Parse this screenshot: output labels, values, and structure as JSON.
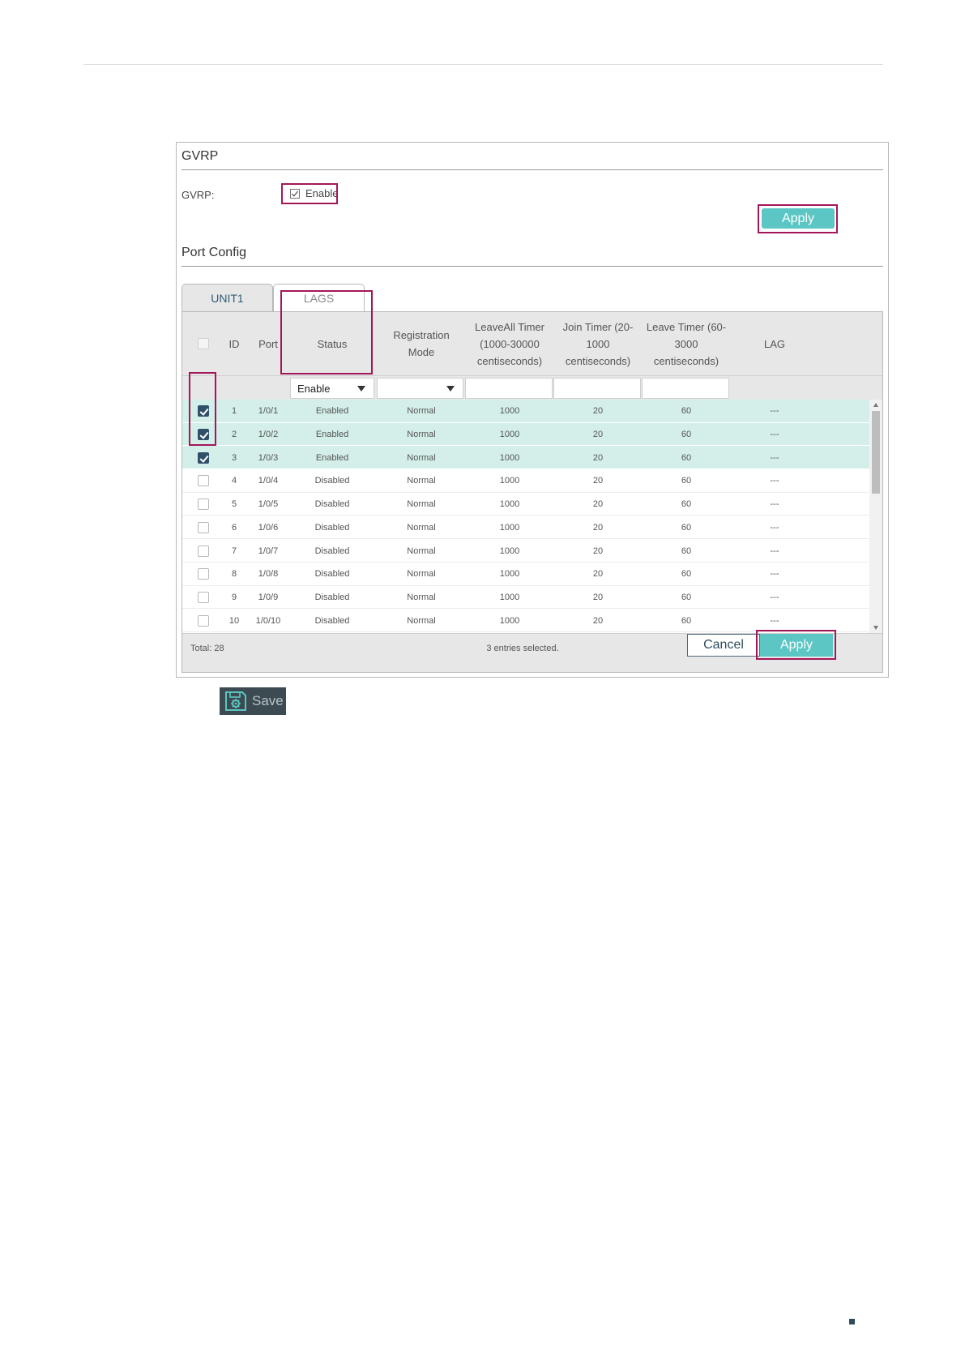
{
  "gvrp": {
    "title": "GVRP",
    "field_label": "GVRP:",
    "enable_label": "Enable",
    "enable_checked": true,
    "apply_label": "Apply"
  },
  "port_config": {
    "title": "Port Config",
    "tabs": [
      {
        "label": "UNIT1",
        "active": true
      },
      {
        "label": "LAGS",
        "active": false
      }
    ],
    "columns": {
      "id": "ID",
      "port": "Port",
      "status": "Status",
      "registration_mode": "Registration Mode",
      "leaveall_timer": "LeaveAll Timer (1000-30000 centiseconds)",
      "join_timer": "Join Timer (20-1000 centiseconds)",
      "leave_timer": "Leave Timer (60-3000 centiseconds)",
      "lag": "LAG"
    },
    "filter": {
      "status": "Enable",
      "registration_mode": "",
      "leaveall_timer": "",
      "join_timer": "",
      "leave_timer": ""
    },
    "rows": [
      {
        "id": "1",
        "port": "1/0/1",
        "status": "Enabled",
        "mode": "Normal",
        "leaveall": "1000",
        "join": "20",
        "leave": "60",
        "lag": "---",
        "checked": true
      },
      {
        "id": "2",
        "port": "1/0/2",
        "status": "Enabled",
        "mode": "Normal",
        "leaveall": "1000",
        "join": "20",
        "leave": "60",
        "lag": "---",
        "checked": true
      },
      {
        "id": "3",
        "port": "1/0/3",
        "status": "Enabled",
        "mode": "Normal",
        "leaveall": "1000",
        "join": "20",
        "leave": "60",
        "lag": "---",
        "checked": true
      },
      {
        "id": "4",
        "port": "1/0/4",
        "status": "Disabled",
        "mode": "Normal",
        "leaveall": "1000",
        "join": "20",
        "leave": "60",
        "lag": "---",
        "checked": false
      },
      {
        "id": "5",
        "port": "1/0/5",
        "status": "Disabled",
        "mode": "Normal",
        "leaveall": "1000",
        "join": "20",
        "leave": "60",
        "lag": "---",
        "checked": false
      },
      {
        "id": "6",
        "port": "1/0/6",
        "status": "Disabled",
        "mode": "Normal",
        "leaveall": "1000",
        "join": "20",
        "leave": "60",
        "lag": "---",
        "checked": false
      },
      {
        "id": "7",
        "port": "1/0/7",
        "status": "Disabled",
        "mode": "Normal",
        "leaveall": "1000",
        "join": "20",
        "leave": "60",
        "lag": "---",
        "checked": false
      },
      {
        "id": "8",
        "port": "1/0/8",
        "status": "Disabled",
        "mode": "Normal",
        "leaveall": "1000",
        "join": "20",
        "leave": "60",
        "lag": "---",
        "checked": false
      },
      {
        "id": "9",
        "port": "1/0/9",
        "status": "Disabled",
        "mode": "Normal",
        "leaveall": "1000",
        "join": "20",
        "leave": "60",
        "lag": "---",
        "checked": false
      },
      {
        "id": "10",
        "port": "1/0/10",
        "status": "Disabled",
        "mode": "Normal",
        "leaveall": "1000",
        "join": "20",
        "leave": "60",
        "lag": "---",
        "checked": false
      }
    ],
    "total": "Total: 28",
    "selected_text": "3 entries selected.",
    "cancel_label": "Cancel",
    "apply_label": "Apply"
  },
  "save": {
    "label": "Save",
    "icon": "save-gear-icon"
  },
  "colors": {
    "accent": "#5bc6c3",
    "highlight_box": "#a3175a",
    "selected_row": "#d4efea",
    "checkbox_checked": "#2f5068"
  }
}
